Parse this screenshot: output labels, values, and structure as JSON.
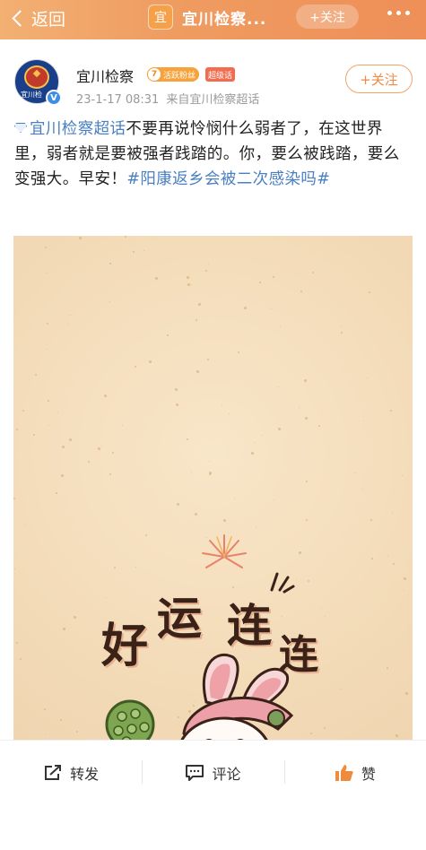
{
  "nav": {
    "back_label": "返回",
    "title_badge": "宜",
    "title": "宜川检察...",
    "follow_label": "+关注"
  },
  "post": {
    "user_name": "宜川检察",
    "avatar_text": "宜川检",
    "fan_level": "7",
    "fan_badge": "活跃粉丝",
    "host_badge": "超级话",
    "time": "23-1-17 08:31",
    "source": "来自宜川检察超话",
    "follow_label": "+关注",
    "topic_link": "宜川检察超话",
    "body": "不要再说怜悯什么弱者了，在这世界里，弱者就是要被强者践踏的。你，要么被践踏，要么变强大。早安！",
    "hashtag": "#阳康返乡会被二次感染吗#"
  },
  "image": {
    "chars": [
      "好",
      "运",
      "连",
      "连"
    ]
  },
  "actions": {
    "repost": "转发",
    "comment": "评论",
    "like": "赞"
  }
}
